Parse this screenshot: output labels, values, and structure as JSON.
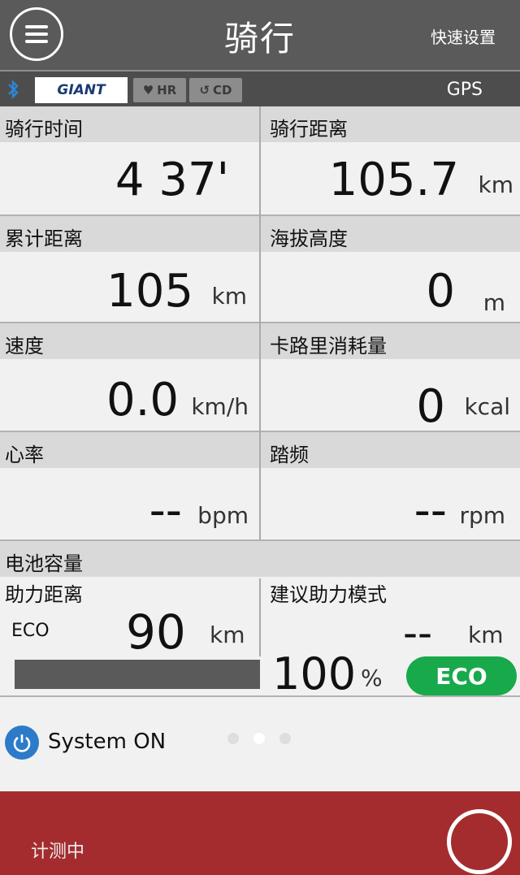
{
  "header": {
    "title": "骑行",
    "quick_settings": "快速设置"
  },
  "status": {
    "brand": "GIANT",
    "hr": "HR",
    "cd": "CD",
    "gps": "GPS"
  },
  "cells": [
    {
      "label": "骑行时间",
      "value": "4 37'",
      "unit": ""
    },
    {
      "label": "骑行距离",
      "value": "105.7",
      "unit": "km"
    },
    {
      "label": "累计距离",
      "value": "105",
      "unit": "km"
    },
    {
      "label": "海拔高度",
      "value": "0",
      "unit": "m"
    },
    {
      "label": "速度",
      "value": "0.0",
      "unit": "km/h"
    },
    {
      "label": "卡路里消耗量",
      "value": "0",
      "unit": "kcal"
    },
    {
      "label": "心率",
      "value": "--",
      "unit": "bpm"
    },
    {
      "label": "踏频",
      "value": "--",
      "unit": "rpm"
    }
  ],
  "battery": {
    "title": "电池容量",
    "assist_label": "助力距离",
    "mode_small": "ECO",
    "assist_value": "90",
    "assist_unit": "km",
    "suggest_label": "建议助力模式",
    "suggest_value": "--",
    "suggest_unit": "km",
    "percent_value": "100",
    "percent_unit": "%",
    "eco_button": "ECO"
  },
  "system": {
    "label": "System ON"
  },
  "footer": {
    "status": "计测中"
  },
  "colors": {
    "header": "#5a5a5a",
    "status_bar": "#4d4d4d",
    "eco": "#17a94a",
    "footer": "#a42c2f"
  }
}
